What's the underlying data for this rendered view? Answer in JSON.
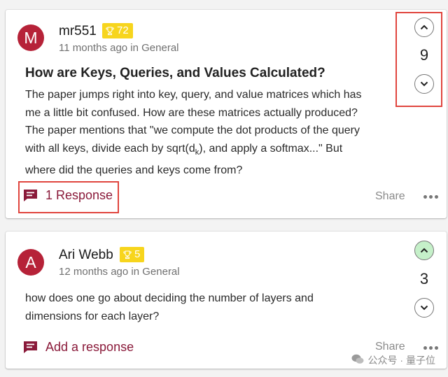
{
  "posts": [
    {
      "avatar_letter": "M",
      "author": "mr551",
      "badge_points": "72",
      "meta": "11 months ago in General",
      "title": "How are Keys, Queries, and Values Calculated?",
      "body_lines": [
        "The paper jumps right into key, query, and value matrices which has",
        "me a little bit confused. How are these matrices actually produced?",
        "The paper mentions that \"we compute the dot products of the query",
        "with all keys, divide each by sqrt(d",
        "k",
        "), and apply a softmax...\" But",
        "where did the queries and keys come from?"
      ],
      "response_label": "1 Response",
      "share_label": "Share",
      "votes": "9"
    },
    {
      "avatar_letter": "A",
      "author": "Ari Webb",
      "badge_points": "5",
      "meta": "12 months ago in General",
      "body_lines": [
        "how does one go about deciding the number of layers and",
        "dimensions for each layer?"
      ],
      "response_label": "Add a response",
      "share_label": "Share",
      "votes": "3"
    }
  ],
  "colors": {
    "avatar": "#b62238",
    "badge": "#f7d51d",
    "response": "#8a1a3a",
    "highlight_box": "#e0453e",
    "upvote_active": "#c5f0c9"
  },
  "icons": {
    "badge": "trophy-icon",
    "response": "comment-icon",
    "upvote": "chevron-up-icon",
    "downvote": "chevron-down-icon",
    "more": "more-horizontal-icon"
  },
  "watermark": {
    "text": "公众号 · 量子位"
  }
}
